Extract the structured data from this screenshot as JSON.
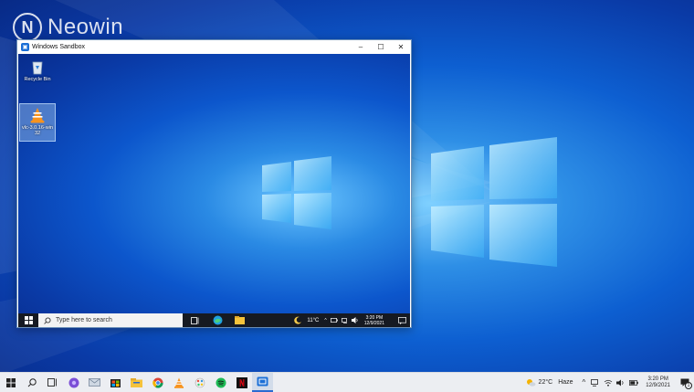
{
  "watermark": {
    "brand": "Neowin"
  },
  "sandbox_window": {
    "title": "Windows Sandbox",
    "controls": {
      "minimize": "–",
      "maximize": "☐",
      "close": "✕"
    },
    "desktop_icons": [
      {
        "label": "Recycle Bin",
        "icon": "recycle-bin-icon"
      },
      {
        "label": "vlc-3.0.16-win 32",
        "icon": "vlc-cone-icon"
      }
    ],
    "taskbar": {
      "search_placeholder": "Type here to search",
      "weather": "11°C",
      "time": "3:20 PM",
      "date": "12/9/2021"
    }
  },
  "host_taskbar": {
    "apps": [
      "windows-start-icon",
      "search-icon",
      "task-view-icon",
      "app-purple-icon",
      "mail-icon",
      "store-icon",
      "file-explorer-icon",
      "chrome-icon",
      "vlc-icon",
      "paint-icon",
      "spotify-icon",
      "netflix-icon",
      "sandbox-icon"
    ],
    "weather_temp": "22°C",
    "weather_desc": "Haze",
    "time": "3:20 PM",
    "date": "12/9/2021",
    "notification_count": "1"
  },
  "colors": {
    "accent": "#2a6bd1",
    "taskbar_dark": "#161a22",
    "taskbar_light": "#eceef2"
  }
}
